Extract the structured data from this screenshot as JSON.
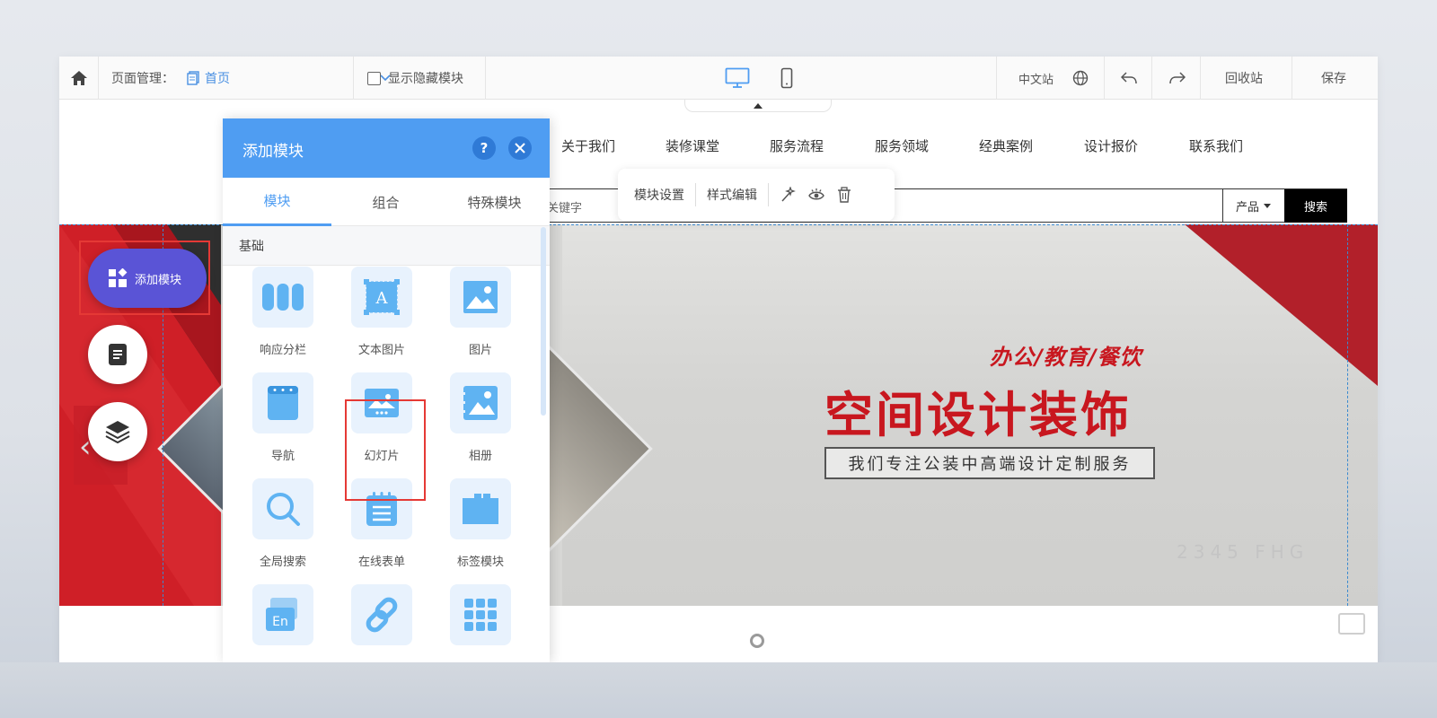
{
  "toolbar": {
    "page_mgr_label": "页面管理：",
    "current_page": "首页",
    "show_hidden_label": "显示隐藏模块",
    "site_lang": "中文站",
    "recycle_label": "回收站",
    "save_label": "保存"
  },
  "site": {
    "nav": [
      "关于我们",
      "装修课堂",
      "服务流程",
      "服务领域",
      "经典案例",
      "设计报价",
      "联系我们"
    ],
    "search_placeholder": "关键字",
    "search_category": "产品",
    "search_button": "搜索"
  },
  "module_toolbar": {
    "settings": "模块设置",
    "style_edit": "样式编辑"
  },
  "banner": {
    "subtitle": "办公/教育/餐饮",
    "headline": "空间设计装饰",
    "tagline": "我们专注公装中高端设计定制服务",
    "watermark": "2345 FHG"
  },
  "fab": {
    "add_module": "添加模块"
  },
  "panel": {
    "title": "添加模块",
    "help": "?",
    "tabs": [
      "模块",
      "组合",
      "特殊模块"
    ],
    "active_tab": "模块",
    "section": "基础",
    "tiles": [
      {
        "label": "响应分栏",
        "icon": "columns-icon"
      },
      {
        "label": "文本图片",
        "icon": "text-image-icon"
      },
      {
        "label": "图片",
        "icon": "image-icon"
      },
      {
        "label": "导航",
        "icon": "navigation-icon"
      },
      {
        "label": "幻灯片",
        "icon": "slideshow-icon"
      },
      {
        "label": "相册",
        "icon": "album-icon"
      },
      {
        "label": "全局搜索",
        "icon": "search-icon"
      },
      {
        "label": "在线表单",
        "icon": "form-icon"
      },
      {
        "label": "标签模块",
        "icon": "tabs-icon"
      },
      {
        "label": "",
        "icon": "language-icon"
      },
      {
        "label": "",
        "icon": "link-icon"
      },
      {
        "label": "",
        "icon": "grid-icon"
      }
    ]
  },
  "colors": {
    "accent_blue": "#4f9df2",
    "fab_purple": "#5a54d6",
    "banner_red": "#c8171f",
    "highlight_red": "#e53935"
  }
}
